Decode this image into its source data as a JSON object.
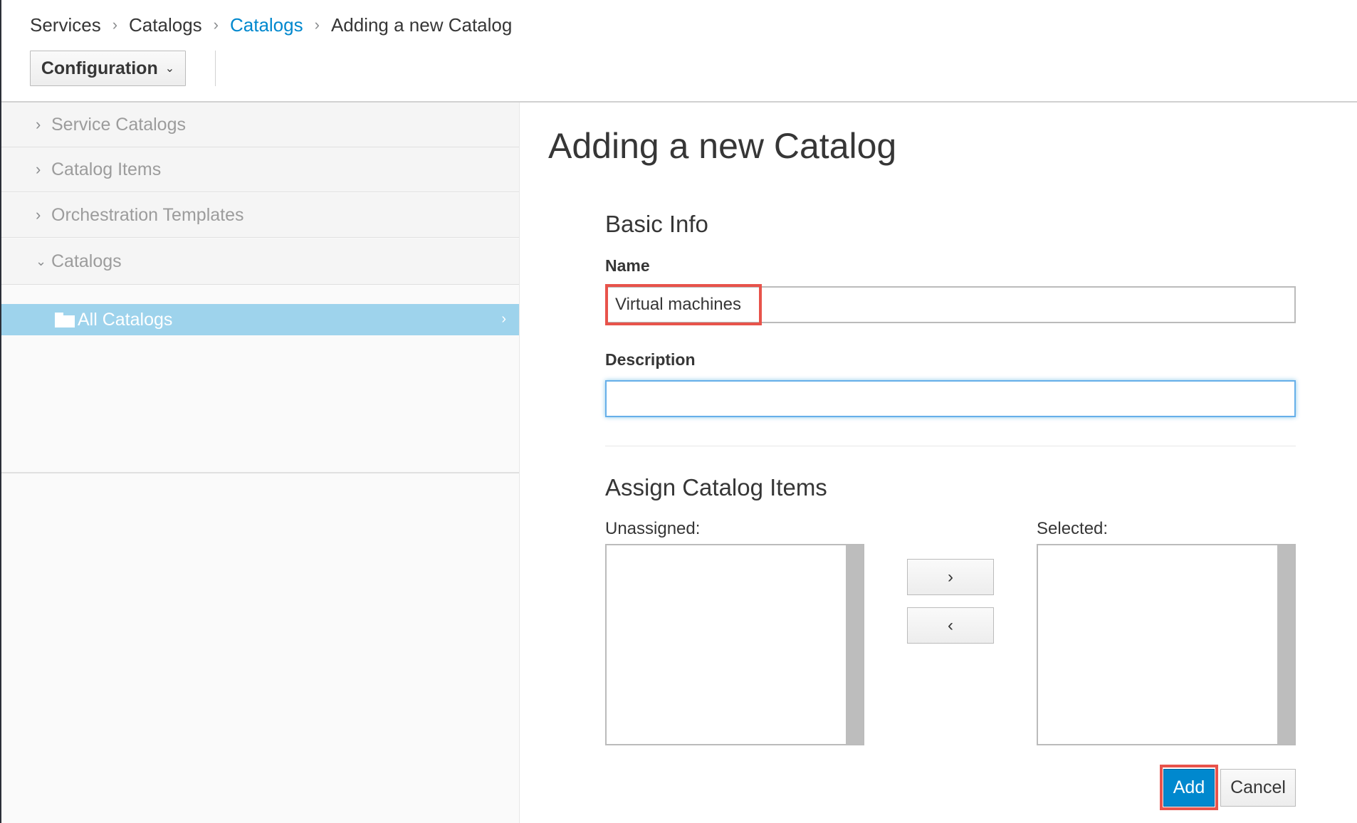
{
  "breadcrumb": {
    "items": [
      "Services",
      "Catalogs",
      "Catalogs",
      "Adding a new Catalog"
    ],
    "separator": "›"
  },
  "toolbar": {
    "configuration_label": "Configuration"
  },
  "sidebar": {
    "accordions": [
      {
        "label": "Service Catalogs",
        "expanded": false
      },
      {
        "label": "Catalog Items",
        "expanded": false
      },
      {
        "label": "Orchestration Templates",
        "expanded": false
      },
      {
        "label": "Catalogs",
        "expanded": true
      }
    ],
    "tree": {
      "selected_item": "All Catalogs"
    }
  },
  "main": {
    "title": "Adding a new Catalog",
    "basic_info": {
      "heading": "Basic Info",
      "name_label": "Name",
      "name_value": "Virtual machines",
      "description_label": "Description",
      "description_value": ""
    },
    "assign": {
      "heading": "Assign Catalog Items",
      "unassigned_label": "Unassigned:",
      "selected_label": "Selected:",
      "move_right": "›",
      "move_left": "‹"
    },
    "buttons": {
      "add": "Add",
      "cancel": "Cancel"
    }
  },
  "colors": {
    "accent": "#0088ce",
    "selected_row": "#9ed3ec",
    "highlight": "#e8534b"
  }
}
